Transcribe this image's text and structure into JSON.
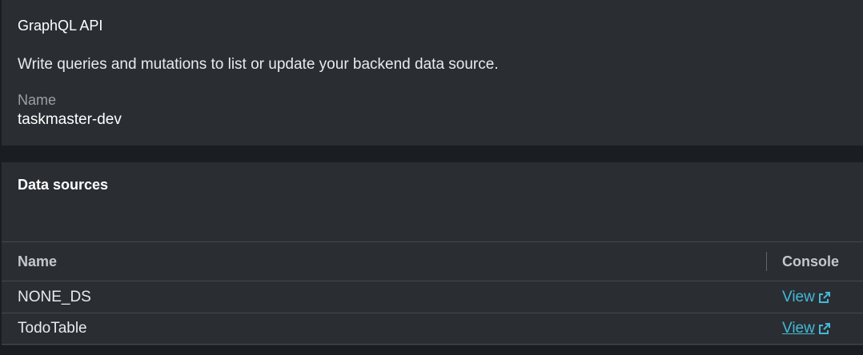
{
  "api_panel": {
    "title": "GraphQL API",
    "description": "Write queries and mutations to list or update your backend data source.",
    "name_label": "Name",
    "name_value": "taskmaster-dev"
  },
  "data_sources": {
    "title": "Data sources",
    "columns": {
      "name": "Name",
      "console": "Console"
    },
    "rows": [
      {
        "name": "NONE_DS",
        "console_link": "View",
        "underlined": false
      },
      {
        "name": "TodoTable",
        "console_link": "View",
        "underlined": true
      }
    ]
  },
  "icons": {
    "external_link": "external-link-icon"
  },
  "colors": {
    "link": "#44b9d6",
    "panel_bg": "#2a2e33",
    "page_bg": "#1a1d22"
  }
}
